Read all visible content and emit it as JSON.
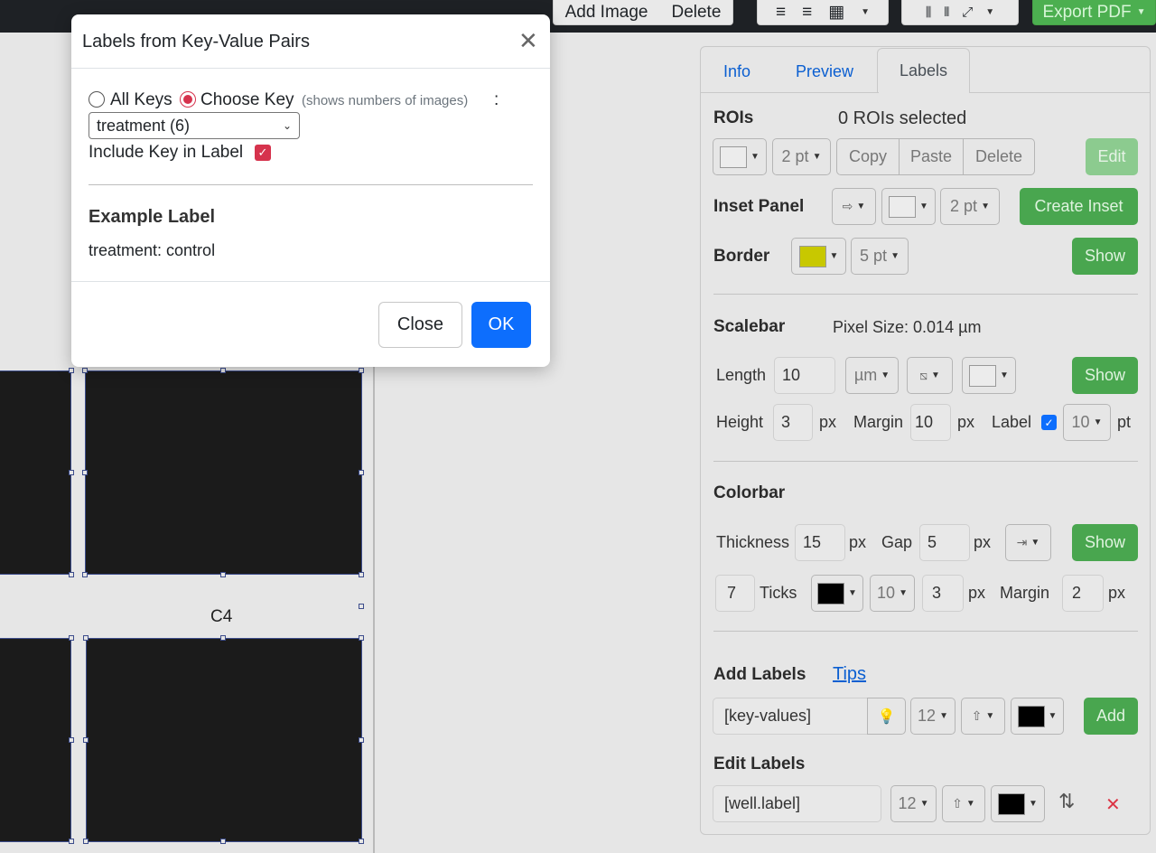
{
  "toolbar": {
    "add_image": "Add Image",
    "delete": "Delete",
    "export_pdf": "Export PDF"
  },
  "canvas": {
    "panel_label": "C4"
  },
  "tabs": [
    {
      "label": "Info"
    },
    {
      "label": "Preview"
    },
    {
      "label": "Labels",
      "active": true
    }
  ],
  "rois": {
    "title": "ROIs",
    "selected": "0 ROIs selected",
    "width": "2 pt",
    "copy": "Copy",
    "paste": "Paste",
    "delete": "Delete",
    "edit": "Edit"
  },
  "inset": {
    "title": "Inset Panel",
    "width": "2 pt",
    "create": "Create Inset"
  },
  "border": {
    "title": "Border",
    "color": "#c8c800",
    "width": "5 pt",
    "show": "Show"
  },
  "scalebar": {
    "title": "Scalebar",
    "pixel_size": "Pixel Size: 0.014 µm",
    "length_label": "Length",
    "length": "10",
    "unit": "µm",
    "show": "Show",
    "height_label": "Height",
    "height": "3",
    "px1": "px",
    "margin_label": "Margin",
    "margin": "10",
    "px2": "px",
    "label_label": "Label",
    "font_size": "10",
    "pt": "pt"
  },
  "colorbar": {
    "title": "Colorbar",
    "thickness_label": "Thickness",
    "thickness": "15",
    "px1": "px",
    "gap_label": "Gap",
    "gap": "5",
    "px2": "px",
    "show": "Show",
    "ticks_count": "7",
    "ticks_label": "Ticks",
    "tick_font": "10",
    "tick_len": "3",
    "px3": "px",
    "margin_label": "Margin",
    "margin": "2",
    "px4": "px"
  },
  "add_labels": {
    "title": "Add Labels",
    "tips": "Tips",
    "input": "[key-values]",
    "size": "12",
    "add": "Add"
  },
  "edit_labels": {
    "title": "Edit Labels",
    "input": "[well.label]",
    "size": "12"
  },
  "modal": {
    "title": "Labels from Key-Value Pairs",
    "all_keys": "All Keys",
    "choose_key": "Choose Key",
    "hint": "(shows numbers of images)",
    "colon": ":",
    "key_select": "treatment (6)",
    "include_key": "Include Key in Label",
    "example_title": "Example Label",
    "example_value": "treatment: control",
    "close": "Close",
    "ok": "OK"
  }
}
